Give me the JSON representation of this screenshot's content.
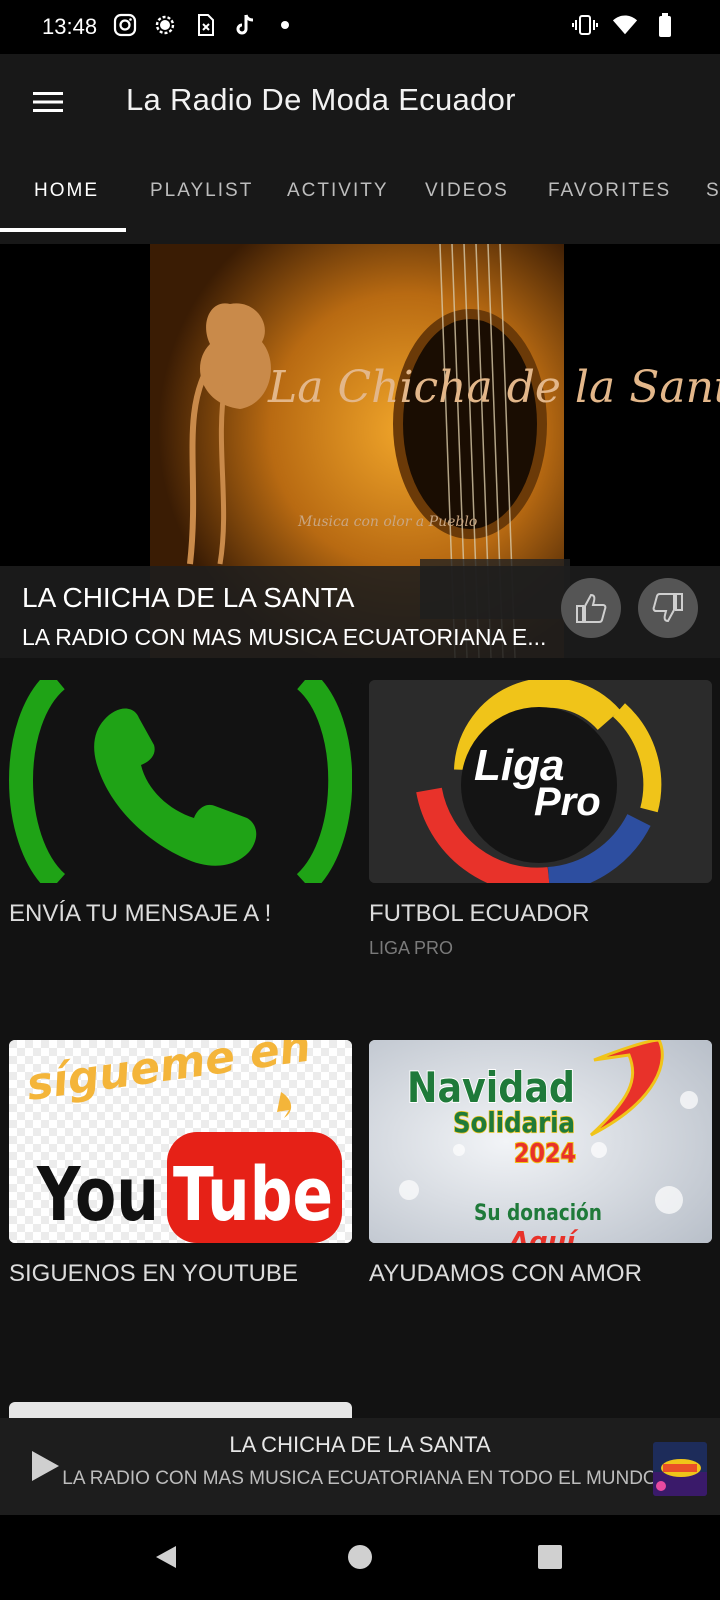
{
  "status": {
    "time": "13:48",
    "left_icons": [
      "instagram-icon",
      "settings-icon",
      "sim-icon",
      "tiktok-icon",
      "dot-icon"
    ],
    "right_icons": [
      "vibrate-icon",
      "wifi-icon",
      "battery-icon"
    ]
  },
  "appbar": {
    "title": "La Radio De Moda Ecuador",
    "menu_icon": "hamburger-menu-icon"
  },
  "tabs": [
    {
      "label": "HOME",
      "active": true
    },
    {
      "label": "PLAYLIST"
    },
    {
      "label": "ACTIVITY"
    },
    {
      "label": "VIDEOS"
    },
    {
      "label": "FAVORITES"
    },
    {
      "label": "S"
    }
  ],
  "hero": {
    "title": "LA CHICHA DE LA SANTA",
    "subtitle": "LA RADIO CON MAS MUSICA ECUATORIANA E...",
    "logo_text": "La Chicha de la Santa",
    "logo_tagline": "Musica con olor a Pueblo"
  },
  "cards": [
    {
      "title": "ENVÍA TU MENSAJE A !",
      "subtitle": "",
      "image": "whatsapp-logo"
    },
    {
      "title": "FUTBOL ECUADOR",
      "subtitle": "LIGA PRO",
      "image": "ligapro-logo",
      "logo_line1": "Liga",
      "logo_line2": "Pro"
    },
    {
      "title": "SIGUENOS EN YOUTUBE",
      "subtitle": "",
      "image": "youtube-banner",
      "img_text1": "sígueme en",
      "img_text2": "You",
      "img_text3": "Tube"
    },
    {
      "title": "AYUDAMOS CON AMOR",
      "subtitle": "",
      "image": "navidad-banner",
      "img_text1": "Navidad",
      "img_text2": "Solidaria",
      "img_text3": "2024",
      "img_text4": "Su donación",
      "img_text5": "Aquí"
    }
  ],
  "player": {
    "title": "LA CHICHA DE LA SANTA",
    "subtitle": "LA RADIO CON MAS MUSICA ECUATORIANA EN TODO EL MUNDO",
    "play_icon": "play-icon"
  },
  "navbar": {
    "icons": [
      "back-icon",
      "home-icon",
      "recents-icon"
    ]
  },
  "colors": {
    "background": "#121212",
    "appbar": "#181818",
    "whatsapp_green": "#1fa316",
    "youtube_red": "#e62117"
  }
}
